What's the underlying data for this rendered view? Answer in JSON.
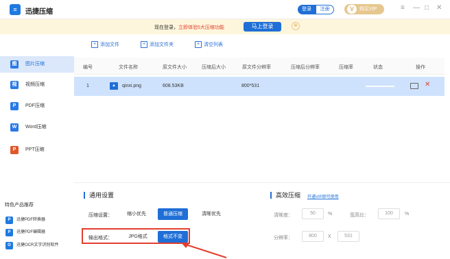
{
  "app": {
    "logo_glyph": "≡",
    "title": "迅捷压缩"
  },
  "header": {
    "login_label": "登录",
    "register_label": "注册",
    "vip_badge": "V",
    "vip_label": "购买VIP",
    "menu_icon": "≡",
    "minimize_icon": "—",
    "maximize_icon": "□",
    "close_icon": "✕"
  },
  "notice": {
    "text_prefix": "现在登录，",
    "text_highlight": "立即体验5大压缩功能",
    "login_button": "马上登录",
    "close_icon": "⊗"
  },
  "sidebar": {
    "items": [
      {
        "label": "图片压缩",
        "icon": "图",
        "active": true
      },
      {
        "label": "视频压缩",
        "icon": "视",
        "active": false
      },
      {
        "label": "PDF压缩",
        "icon": "P",
        "active": false
      },
      {
        "label": "Word压缩",
        "icon": "W",
        "active": false
      },
      {
        "label": "PPT压缩",
        "icon": "P",
        "active": false
      }
    ],
    "products_title": "特色产品推荐",
    "products": [
      {
        "label": "迅捷PDF转换器",
        "icon": "P"
      },
      {
        "label": "迅捷PDF编辑器",
        "icon": "P"
      },
      {
        "label": "迅捷OCR文字识别软件",
        "icon": "O"
      }
    ]
  },
  "toolbar": {
    "add_file": "添加文件",
    "add_folder": "添加文件夹",
    "clear_list": "清空列表"
  },
  "table": {
    "headers": [
      "编号",
      "文件名称",
      "原文件大小",
      "压缩后大小",
      "原文件分辨率",
      "压缩后分辨率",
      "压缩率",
      "状态",
      "操作"
    ],
    "rows": [
      {
        "index": "1",
        "name": "qinxi.png",
        "original_size": "608.53KB",
        "compressed_size": "",
        "original_resolution": "800*531",
        "compressed_resolution": "",
        "ratio": "",
        "status": ""
      }
    ]
  },
  "settings": {
    "general_title": "通用设置",
    "compress_label": "压缩设置：",
    "compress_options": [
      "缩小优先",
      "普通压缩",
      "清晰优先"
    ],
    "compress_selected": "普通压缩",
    "output_label": "输出格式：",
    "output_options": [
      "JPG格式",
      "格式不变"
    ],
    "output_selected": "格式不变",
    "advanced_title": "高效压缩",
    "vip_link": "开通VIP即可使用",
    "clarity_label": "清晰度：",
    "clarity_value": "50",
    "clarity_unit": "%",
    "width_ratio_label": "宽高比：",
    "width_ratio_value": "100",
    "width_ratio_unit": "%",
    "resolution_label": "分辨率：",
    "resolution_width": "800",
    "resolution_sep": "X",
    "resolution_height": "531"
  },
  "colors": {
    "accent": "#1f6fd6",
    "highlight": "#e23d2e",
    "selected_row": "#cfe2fd",
    "notice_bg": "#fdf6dc"
  }
}
